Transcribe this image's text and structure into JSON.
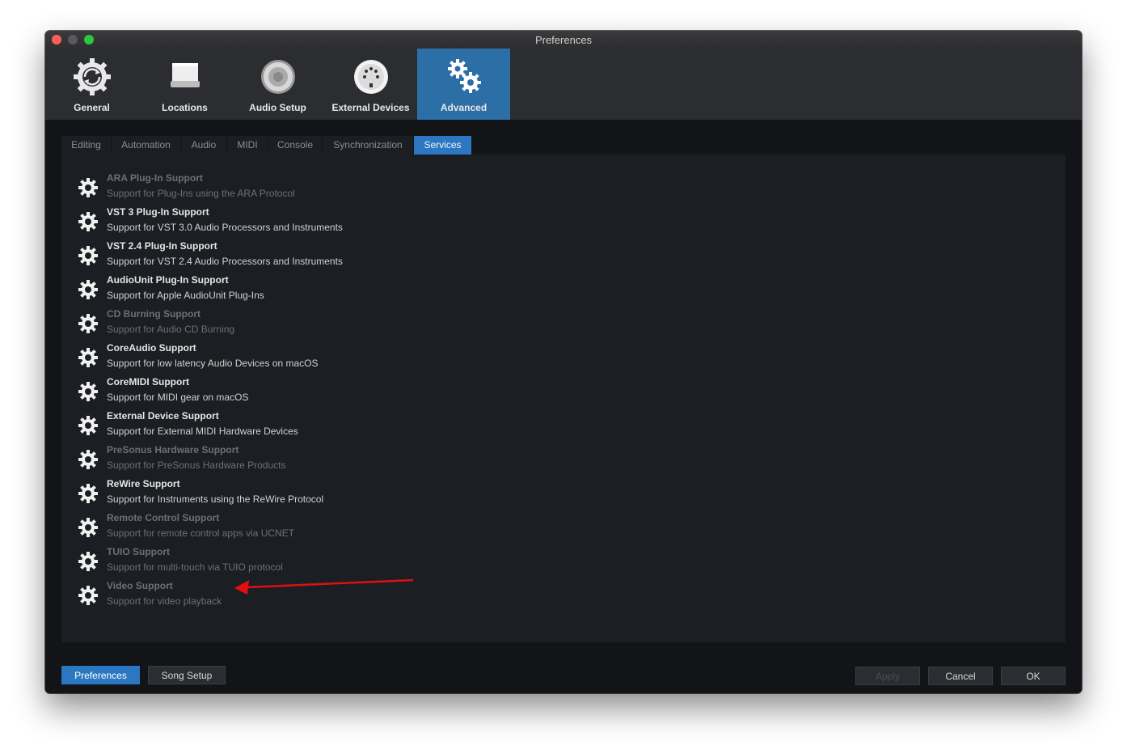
{
  "window": {
    "title": "Preferences"
  },
  "toolbar": {
    "items": [
      {
        "label": "General",
        "icon": "sync-gear-icon"
      },
      {
        "label": "Locations",
        "icon": "drive-icon"
      },
      {
        "label": "Audio Setup",
        "icon": "speaker-icon"
      },
      {
        "label": "External Devices",
        "icon": "midi-port-icon"
      },
      {
        "label": "Advanced",
        "icon": "gears-icon",
        "active": true
      }
    ]
  },
  "subtabs": [
    {
      "label": "Editing"
    },
    {
      "label": "Automation"
    },
    {
      "label": "Audio"
    },
    {
      "label": "MIDI"
    },
    {
      "label": "Console"
    },
    {
      "label": "Synchronization"
    },
    {
      "label": "Services",
      "active": true
    }
  ],
  "services": [
    {
      "title": "ARA Plug-In Support",
      "desc": "Support for Plug-Ins using the ARA Protocol",
      "enabled": false
    },
    {
      "title": "VST 3 Plug-In Support",
      "desc": "Support for VST 3.0 Audio Processors and Instruments",
      "enabled": true
    },
    {
      "title": "VST 2.4 Plug-In Support",
      "desc": "Support for VST 2.4 Audio Processors and Instruments",
      "enabled": true
    },
    {
      "title": "AudioUnit Plug-In Support",
      "desc": "Support for Apple AudioUnit Plug-Ins",
      "enabled": true
    },
    {
      "title": "CD Burning Support",
      "desc": "Support for Audio CD Burning",
      "enabled": false
    },
    {
      "title": "CoreAudio Support",
      "desc": "Support for low latency Audio Devices on macOS",
      "enabled": true
    },
    {
      "title": "CoreMIDI Support",
      "desc": "Support for MIDI gear on macOS",
      "enabled": true
    },
    {
      "title": "External Device Support",
      "desc": "Support for External MIDI Hardware Devices",
      "enabled": true
    },
    {
      "title": "PreSonus Hardware Support",
      "desc": "Support for PreSonus Hardware Products",
      "enabled": false
    },
    {
      "title": "ReWire Support",
      "desc": "Support for Instruments using the ReWire Protocol",
      "enabled": true
    },
    {
      "title": "Remote Control Support",
      "desc": "Support for remote control apps via UCNET",
      "enabled": false
    },
    {
      "title": "TUIO Support",
      "desc": "Support for multi-touch via TUIO protocol",
      "enabled": false
    },
    {
      "title": "Video Support",
      "desc": "Support for video playback",
      "enabled": false
    }
  ],
  "footer": {
    "preferences_label": "Preferences",
    "song_setup_label": "Song Setup",
    "apply_label": "Apply",
    "cancel_label": "Cancel",
    "ok_label": "OK"
  },
  "colors": {
    "accent": "#2c77c1",
    "annotation_arrow": "#e01010"
  }
}
